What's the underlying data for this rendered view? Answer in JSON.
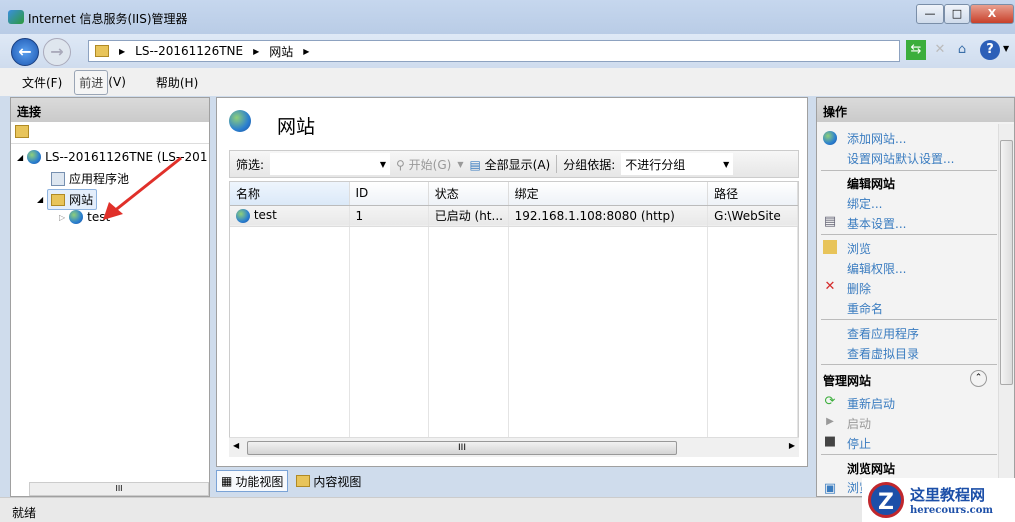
{
  "window": {
    "title": "Internet 信息服务(IIS)管理器",
    "minimize": "—",
    "maximize": "□",
    "close": "X"
  },
  "nav": {
    "back": "←",
    "forward": "→",
    "breadcrumb": [
      "LS--20161126TNE",
      "网站"
    ],
    "sep": "▶",
    "tools": [
      "refresh-icon",
      "stop-icon",
      "home-icon",
      "help-icon"
    ]
  },
  "menu": {
    "file": "文件(F)",
    "pressed": "前进",
    "view": "(V)",
    "help": "帮助(H)"
  },
  "connections": {
    "title": "连接",
    "tree": {
      "server": "LS--20161126TNE (LS--201",
      "apppools": "应用程序池",
      "sites": "网站",
      "site": "test"
    }
  },
  "center": {
    "title": "网站",
    "filter_label": "筛选:",
    "filter_value": "",
    "go": "开始(G)",
    "show_all": "全部显示(A)",
    "group_label": "分组依据:",
    "group_value": "不进行分组",
    "columns": [
      "名称",
      "ID",
      "状态",
      "绑定",
      "路径"
    ],
    "rows": [
      {
        "name": "test",
        "id": "1",
        "status": "已启动 (ht...",
        "binding": "192.168.1.108:8080 (http)",
        "path": "G:\\WebSite"
      }
    ],
    "scroll_grip": "III"
  },
  "tabs": {
    "features": "功能视图",
    "content": "内容视图"
  },
  "actions": {
    "title": "操作",
    "add_site": "添加网站...",
    "defaults": "设置网站默认设置...",
    "edit_site": "编辑网站",
    "bindings": "绑定...",
    "basic": "基本设置...",
    "explore": "浏览",
    "permissions": "编辑权限...",
    "remove": "删除",
    "rename": "重命名",
    "view_apps": "查看应用程序",
    "view_vdirs": "查看虚拟目录",
    "manage": "管理网站",
    "restart": "重新启动",
    "start": "启动",
    "stop": "停止",
    "browse_site": "浏览网站",
    "browse": "浏览"
  },
  "status": "就绪",
  "watermark": {
    "name": "这里教程网",
    "url": "herecours.com"
  },
  "colors": {
    "link": "#3a7cc0",
    "arrow": "#e0302a"
  }
}
